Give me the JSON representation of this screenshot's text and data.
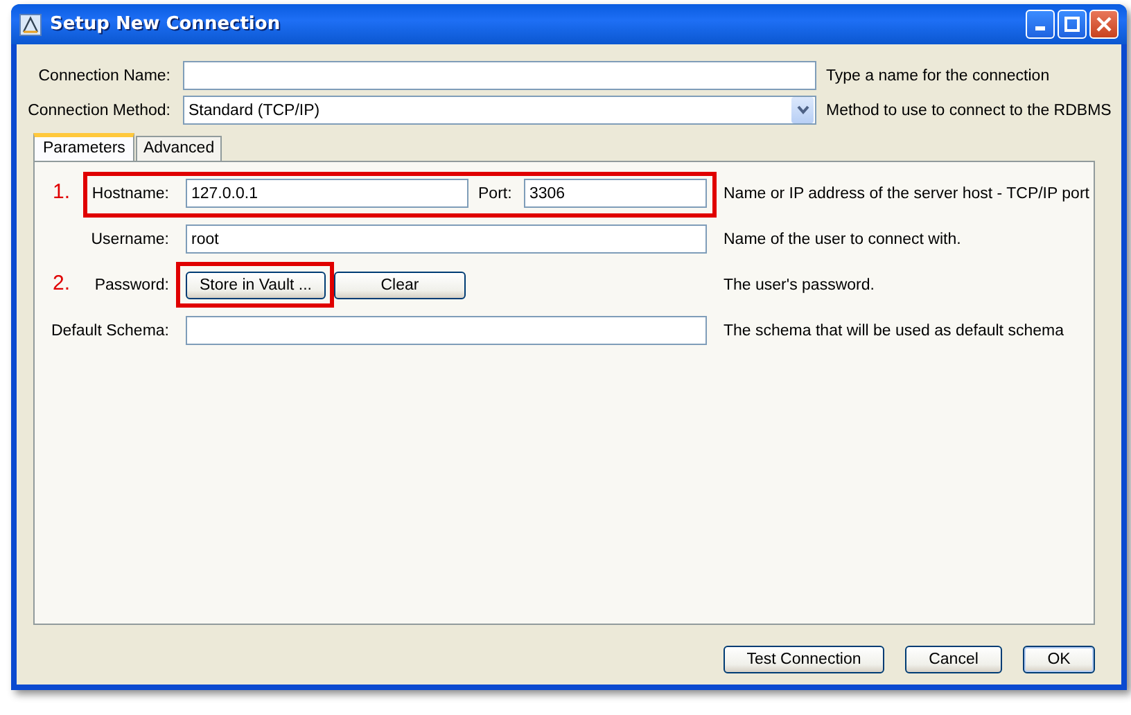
{
  "window": {
    "title": "Setup New Connection"
  },
  "top_fields": [
    {
      "kind": "text",
      "label": "Connection Name:",
      "hint": "Type a name for the connection"
    },
    {
      "kind": "dropdown",
      "label": "Connection Method:",
      "value": "Standard (TCP/IP)",
      "hint": "Method to use to connect to the RDBMS"
    }
  ],
  "tabs": [
    {
      "label": "Parameters",
      "selected": true
    },
    {
      "label": "Advanced",
      "selected": false
    }
  ],
  "parameters": [
    {
      "kind": "host_port",
      "marker": "1.",
      "highlighted": true,
      "label": "Hostname:",
      "value": "127.0.0.1",
      "port_label": "Port:",
      "port_value": "3306",
      "hint": "Name or IP address of the server host - TCP/IP port"
    },
    {
      "kind": "text",
      "label": "Username:",
      "value": "root",
      "hint": "Name of the user to connect with."
    },
    {
      "kind": "buttons",
      "marker": "2.",
      "highlighted": true,
      "label": "Password:",
      "buttons": [
        "Store in Vault ...",
        "Clear"
      ],
      "hint": "The user's password."
    },
    {
      "kind": "text",
      "label": "Default Schema:",
      "hint": "The schema that will be used as default schema"
    }
  ],
  "buttons": [
    "Test Connection",
    "Cancel",
    "OK"
  ]
}
